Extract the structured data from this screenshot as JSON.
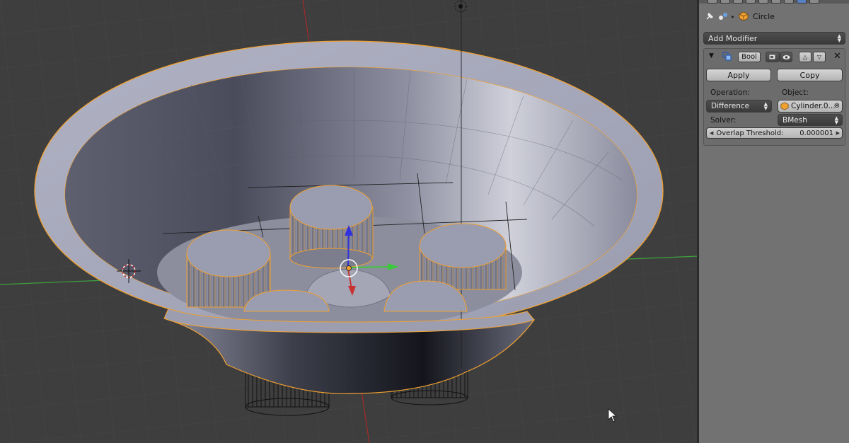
{
  "properties": {
    "breadcrumb": {
      "object_name": "Circle"
    },
    "add_modifier_label": "Add Modifier",
    "modifier": {
      "name": "Bool",
      "apply_label": "Apply",
      "copy_label": "Copy",
      "operation_label": "Operation:",
      "operation_value": "Difference",
      "object_label": "Object:",
      "object_value": "Cylinder.0...",
      "solver_label": "Solver:",
      "solver_value": "BMesh",
      "overlap_label": "Overlap Threshold:",
      "overlap_value": "0.000001"
    }
  },
  "icons": [
    "pin-icon",
    "scene-links-icon",
    "mesh-cube-icon",
    "collapse-triangle-icon",
    "modifier-icon",
    "render-camera-icon",
    "eye-icon",
    "move-up-icon",
    "move-down-icon",
    "close-icon",
    "mouse-cursor-icon",
    "3d-cursor-icon",
    "light-icon"
  ],
  "colors": {
    "selection_outline": "#f0a030",
    "x_axis": "#c83232",
    "y_axis": "#3cc83c",
    "z_axis": "#3232dc",
    "viewport_bg": "#3e3e3e",
    "panel_bg": "#727272"
  }
}
